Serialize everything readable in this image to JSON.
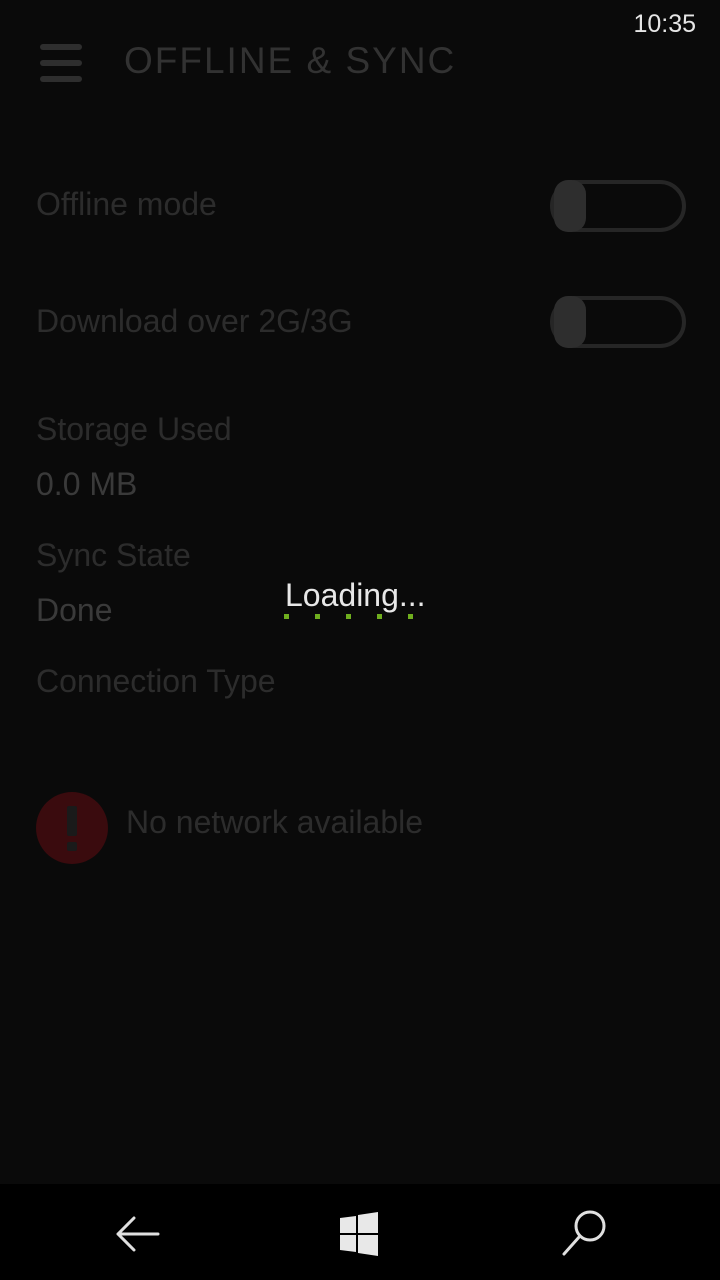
{
  "status_bar": {
    "time": "10:35"
  },
  "header": {
    "menu_icon": "hamburger-icon",
    "title": "OFFLINE & SYNC"
  },
  "settings": {
    "offline_mode": {
      "label": "Offline mode",
      "enabled": false
    },
    "download_over_cellular": {
      "label": "Download over 2G/3G",
      "enabled": false
    },
    "storage": {
      "label": "Storage Used",
      "value": "0.0 MB"
    },
    "sync": {
      "label": "Sync State",
      "value": "Done"
    },
    "connection": {
      "label": "Connection Type",
      "value": ""
    }
  },
  "network_error": {
    "icon": "exclamation-icon",
    "message": "No network available",
    "color": "#3a0b0e"
  },
  "loading": {
    "label": "Loading...",
    "accent": "#6fae1e"
  },
  "navbar": {
    "back_icon": "back-arrow-icon",
    "home_icon": "windows-logo-icon",
    "search_icon": "search-icon"
  }
}
